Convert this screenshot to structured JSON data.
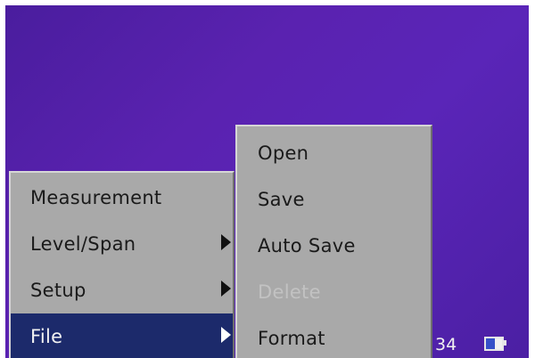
{
  "main_menu": {
    "items": [
      {
        "label": "Measurement",
        "has_submenu": false,
        "selected": false
      },
      {
        "label": "Level/Span",
        "has_submenu": true,
        "selected": false
      },
      {
        "label": "Setup",
        "has_submenu": true,
        "selected": false
      },
      {
        "label": "File",
        "has_submenu": true,
        "selected": true
      }
    ]
  },
  "file_submenu": {
    "items": [
      {
        "label": "Open",
        "enabled": true
      },
      {
        "label": "Save",
        "enabled": true
      },
      {
        "label": "Auto Save",
        "enabled": true
      },
      {
        "label": "Delete",
        "enabled": false
      },
      {
        "label": "Format",
        "enabled": true
      }
    ]
  },
  "status": {
    "counter": "34",
    "battery_icon": "battery-icon"
  },
  "colors": {
    "background": "#5a22b0",
    "menu": "#a9a9a9",
    "selected": "#1c2a6b"
  }
}
